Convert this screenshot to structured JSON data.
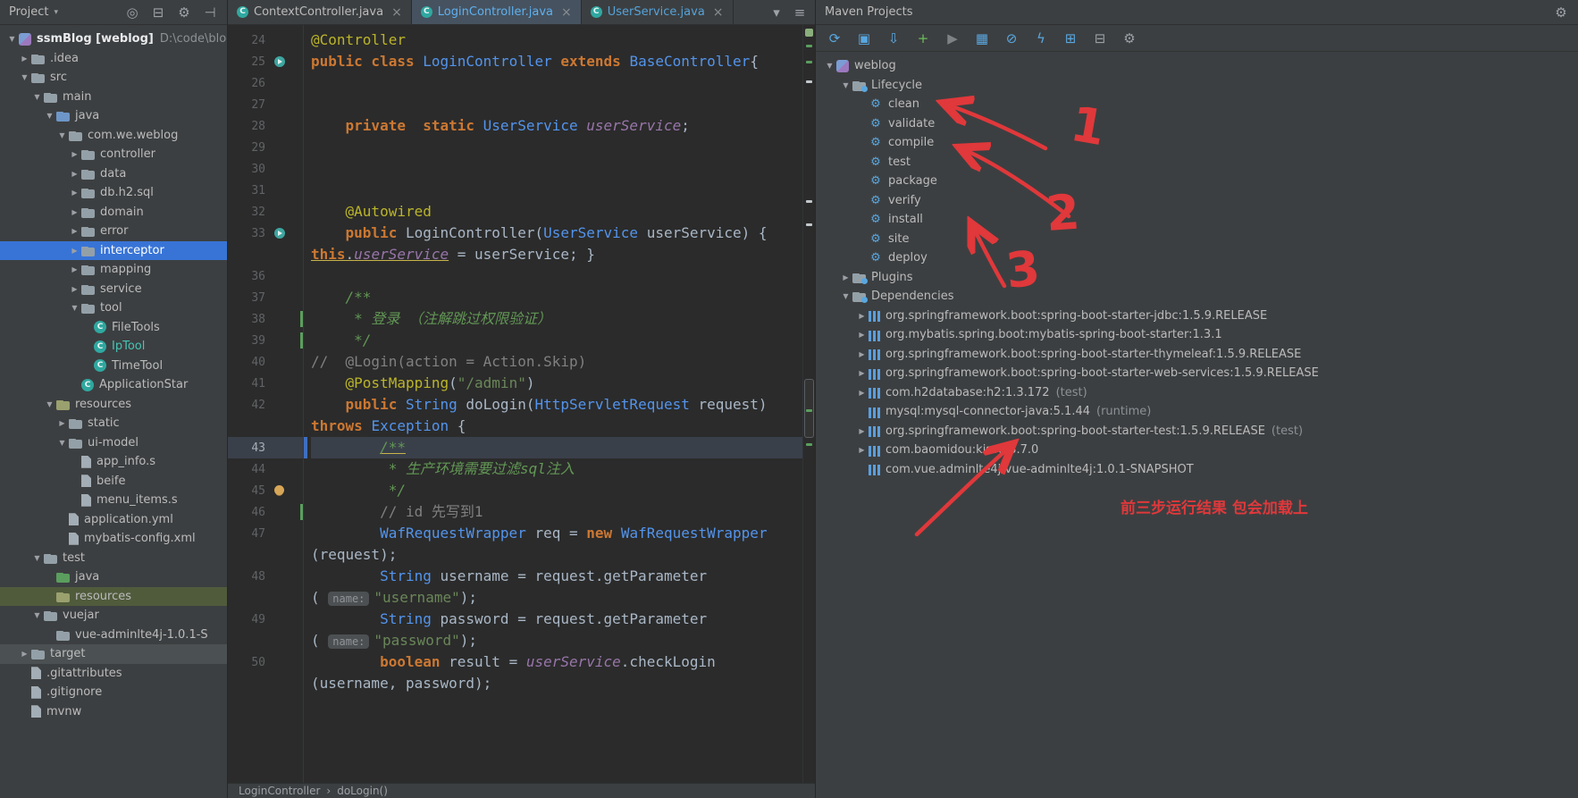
{
  "colors": {
    "selection_blue": "#3874D6",
    "annotation_red": "#E0383B",
    "keyword_orange": "#CC7832",
    "string_green": "#6A8759",
    "class_blue": "#5394EC",
    "annotation_yellow": "#BBB529",
    "doc_comment_green": "#629755",
    "panel_bg": "#3C3F41",
    "editor_bg": "#2B2B2B"
  },
  "icons": {
    "chevron_down": "▼",
    "chevron_right": "▶",
    "close": "×",
    "class_letter": "C",
    "goal_glyph": "⚙",
    "breadcrumb_sep": "›",
    "dropdown": "▾",
    "gear": "⚙"
  },
  "project_panel": {
    "title": "Project",
    "icons": [
      {
        "name": "locate-file",
        "glyph": "◎"
      },
      {
        "name": "collapse-all",
        "glyph": "⊟"
      },
      {
        "name": "settings-gear",
        "glyph": "⚙"
      },
      {
        "name": "hide-panel",
        "glyph": "⊣"
      }
    ],
    "tree": [
      {
        "label": "ssmBlog [weblog]",
        "extra": "D:\\code\\blog",
        "depth": 0,
        "arrow": "down",
        "icon": "module",
        "bold": true,
        "color": "#E8EAEC"
      },
      {
        "label": ".idea",
        "depth": 1,
        "arrow": "right",
        "icon": "folder"
      },
      {
        "label": "src",
        "depth": 1,
        "arrow": "down",
        "icon": "folder"
      },
      {
        "label": "main",
        "depth": 2,
        "arrow": "down",
        "icon": "folder"
      },
      {
        "label": "java",
        "depth": 3,
        "arrow": "down",
        "icon": "srcfolder"
      },
      {
        "label": "com.we.weblog",
        "depth": 4,
        "arrow": "down",
        "icon": "folder"
      },
      {
        "label": "controller",
        "depth": 5,
        "arrow": "right",
        "icon": "folder"
      },
      {
        "label": "data",
        "depth": 5,
        "arrow": "right",
        "icon": "folder"
      },
      {
        "label": "db.h2.sql",
        "depth": 5,
        "arrow": "right",
        "icon": "folder"
      },
      {
        "label": "domain",
        "depth": 5,
        "arrow": "right",
        "icon": "folder"
      },
      {
        "label": "error",
        "depth": 5,
        "arrow": "right",
        "icon": "folder"
      },
      {
        "label": "interceptor",
        "depth": 5,
        "arrow": "right",
        "icon": "folder",
        "selected": true
      },
      {
        "label": "mapping",
        "depth": 5,
        "arrow": "right",
        "icon": "folder"
      },
      {
        "label": "service",
        "depth": 5,
        "arrow": "right",
        "icon": "folder"
      },
      {
        "label": "tool",
        "depth": 5,
        "arrow": "down",
        "icon": "folder"
      },
      {
        "label": "FileTools",
        "depth": 6,
        "icon": "class"
      },
      {
        "label": "IpTool",
        "depth": 6,
        "icon": "class",
        "color": "#49C4B4"
      },
      {
        "label": "TimeTool",
        "depth": 6,
        "icon": "class"
      },
      {
        "label": "ApplicationStar",
        "depth": 5,
        "icon": "class"
      },
      {
        "label": "resources",
        "depth": 3,
        "arrow": "down",
        "icon": "resfolder"
      },
      {
        "label": "static",
        "depth": 4,
        "arrow": "right",
        "icon": "folder"
      },
      {
        "label": "ui-model",
        "depth": 4,
        "arrow": "down",
        "icon": "folder"
      },
      {
        "label": "app_info.s",
        "depth": 5,
        "icon": "file"
      },
      {
        "label": "beife",
        "depth": 5,
        "icon": "file"
      },
      {
        "label": "menu_items.s",
        "depth": 5,
        "icon": "file"
      },
      {
        "label": "application.yml",
        "depth": 4,
        "icon": "yml"
      },
      {
        "label": "mybatis-config.xml",
        "depth": 4,
        "icon": "xml"
      },
      {
        "label": "test",
        "depth": 2,
        "arrow": "down",
        "icon": "folder"
      },
      {
        "label": "java",
        "depth": 3,
        "icon": "testfolder"
      },
      {
        "label": "resources",
        "depth": 3,
        "icon": "resfolder",
        "rowbg": "#505B3C"
      },
      {
        "label": "vuejar",
        "depth": 2,
        "arrow": "down",
        "icon": "folder"
      },
      {
        "label": "vue-adminlte4j-1.0.1-S",
        "depth": 3,
        "icon": "folder"
      },
      {
        "label": "target",
        "depth": 1,
        "arrow": "right",
        "icon": "folder",
        "rowbg": "#4B5052"
      },
      {
        "label": ".gitattributes",
        "depth": 1,
        "icon": "file"
      },
      {
        "label": ".gitignore",
        "depth": 1,
        "icon": "file"
      },
      {
        "label": "mvnw",
        "depth": 1,
        "icon": "file"
      }
    ]
  },
  "editor": {
    "tabs": [
      {
        "label": "ContextController.java",
        "active": false,
        "tint": "#BBBBBB"
      },
      {
        "label": "LoginController.java",
        "active": true,
        "tint": "#5FB0EE"
      },
      {
        "label": "UserService.java",
        "active": false,
        "tint": "#55A2D8"
      }
    ],
    "tab_icons": [
      {
        "name": "show-tabs-list",
        "glyph": "▾"
      },
      {
        "name": "editor-options-menu",
        "glyph": "≡"
      }
    ],
    "breadcrumb": [
      "LoginController",
      "doLogin()"
    ],
    "rows": [
      {
        "num": "24",
        "seg": [
          [
            "@Controller",
            "ann"
          ]
        ]
      },
      {
        "num": "25",
        "gutter": "bean",
        "seg": [
          [
            "public class ",
            "kw"
          ],
          [
            "LoginController",
            "cls"
          ],
          [
            " ",
            "pln"
          ],
          [
            "extends",
            "kw"
          ],
          [
            " ",
            "pln"
          ],
          [
            "BaseController",
            "cls"
          ],
          [
            "{",
            "pln"
          ]
        ]
      },
      {
        "num": "26",
        "seg": []
      },
      {
        "num": "27",
        "seg": []
      },
      {
        "num": "28",
        "seg": [
          [
            "    ",
            "pln"
          ],
          [
            "private  static ",
            "kw"
          ],
          [
            "UserService",
            "cls"
          ],
          [
            " ",
            "pln"
          ],
          [
            "userService",
            "fld"
          ],
          [
            ";",
            "pln"
          ]
        ]
      },
      {
        "num": "29",
        "seg": []
      },
      {
        "num": "30",
        "seg": []
      },
      {
        "num": "31",
        "seg": []
      },
      {
        "num": "32",
        "seg": [
          [
            "    ",
            "pln"
          ],
          [
            "@Autowired",
            "ann"
          ]
        ]
      },
      {
        "num": "33",
        "gutter": "bean",
        "seg": [
          [
            "    ",
            "pln"
          ],
          [
            "public ",
            "kw"
          ],
          [
            "LoginController(",
            "pln"
          ],
          [
            "UserService",
            "cls"
          ],
          [
            " userService) { ",
            "pln"
          ]
        ]
      },
      {
        "num": "",
        "seg": [
          [
            "this",
            "kw ul"
          ],
          [
            ".",
            "pln ul"
          ],
          [
            "userService",
            "fld ul"
          ],
          [
            " = userService; }",
            "pln"
          ]
        ]
      },
      {
        "num": "36",
        "seg": []
      },
      {
        "num": "37",
        "seg": [
          [
            "    ",
            "pln"
          ],
          [
            "/**",
            "doc"
          ]
        ]
      },
      {
        "num": "38",
        "change": true,
        "seg": [
          [
            "     * 登录 （注解跳过权限验证）",
            "doc"
          ]
        ]
      },
      {
        "num": "39",
        "change": true,
        "seg": [
          [
            "     */",
            "doc"
          ]
        ]
      },
      {
        "num": "40",
        "seg": [
          [
            "//  @Login(action = Action.Skip)",
            "cmt"
          ]
        ]
      },
      {
        "num": "41",
        "seg": [
          [
            "    ",
            "pln"
          ],
          [
            "@PostMapping",
            "ann"
          ],
          [
            "(",
            "pln"
          ],
          [
            "\"/admin\"",
            "str"
          ],
          [
            ")",
            "pln"
          ]
        ]
      },
      {
        "num": "42",
        "seg": [
          [
            "    ",
            "pln"
          ],
          [
            "public ",
            "kw"
          ],
          [
            "String",
            "cls"
          ],
          [
            " doLogin(",
            "pln"
          ],
          [
            "HttpServletRequest",
            "cls"
          ],
          [
            " request)",
            "pln"
          ]
        ]
      },
      {
        "num": "",
        "seg": [
          [
            "throws",
            "kw"
          ],
          [
            " ",
            "pln"
          ],
          [
            "Exception",
            "cls"
          ],
          [
            " {",
            "pln"
          ]
        ]
      },
      {
        "num": "43",
        "caret": true,
        "seg": [
          [
            "        ",
            "pln"
          ],
          [
            "/**",
            "doc ul"
          ]
        ]
      },
      {
        "num": "44",
        "seg": [
          [
            "         * 生产环境需要过滤sql注入",
            "doc"
          ]
        ]
      },
      {
        "num": "45",
        "gutter": "bulb",
        "seg": [
          [
            "         */",
            "doc"
          ]
        ]
      },
      {
        "num": "46",
        "change": true,
        "seg": [
          [
            "        ",
            "pln"
          ],
          [
            "// id 先写到1",
            "cmt"
          ]
        ]
      },
      {
        "num": "47",
        "seg": [
          [
            "        ",
            "pln"
          ],
          [
            "WafRequestWrapper",
            "cls"
          ],
          [
            " req = ",
            "pln"
          ],
          [
            "new",
            "kw"
          ],
          [
            " ",
            "pln"
          ],
          [
            "WafRequestWrapper",
            "cls"
          ]
        ]
      },
      {
        "num": "",
        "seg": [
          [
            "(request);",
            "pln"
          ]
        ]
      },
      {
        "num": "48",
        "seg": [
          [
            "        ",
            "pln"
          ],
          [
            "String",
            "cls"
          ],
          [
            " username = request.getParameter",
            "pln"
          ]
        ]
      },
      {
        "num": "",
        "seg": [
          [
            "( ",
            "pln"
          ],
          [
            "name:",
            "hint"
          ],
          [
            "\"username\"",
            "str"
          ],
          [
            ");",
            "pln"
          ]
        ]
      },
      {
        "num": "49",
        "seg": [
          [
            "        ",
            "pln"
          ],
          [
            "String",
            "cls"
          ],
          [
            " password = request.getParameter",
            "pln"
          ]
        ]
      },
      {
        "num": "",
        "seg": [
          [
            "( ",
            "pln"
          ],
          [
            "name:",
            "hint"
          ],
          [
            "\"password\"",
            "str"
          ],
          [
            ");",
            "pln"
          ]
        ]
      },
      {
        "num": "50",
        "seg": [
          [
            "        ",
            "pln"
          ],
          [
            "boolean",
            "kw"
          ],
          [
            " result = ",
            "pln"
          ],
          [
            "userService",
            "fld"
          ],
          [
            ".checkLogin",
            "pln"
          ]
        ]
      },
      {
        "num": "",
        "seg": [
          [
            "(username, password);",
            "pln"
          ]
        ]
      }
    ]
  },
  "maven": {
    "title": "Maven Projects",
    "toolbar": [
      {
        "name": "reimport-all-maven-projects",
        "glyph": "⟳",
        "color": "#59A7E0"
      },
      {
        "name": "generate-sources",
        "glyph": "▣",
        "color": "#59A7E0"
      },
      {
        "name": "download-sources",
        "glyph": "⇩",
        "color": "#59A7E0"
      },
      {
        "name": "add-maven-project",
        "glyph": "+",
        "color": "#6CBE59"
      },
      {
        "name": "run-maven-build",
        "glyph": "▶",
        "color": "#7E8284"
      },
      {
        "name": "execute-maven-goal",
        "glyph": "▦",
        "color": "#59A7E0"
      },
      {
        "name": "toggle-offline-mode",
        "glyph": "⊘",
        "color": "#59A7E0"
      },
      {
        "name": "skip-tests-mode",
        "glyph": "ϟ",
        "color": "#59A7E0"
      },
      {
        "name": "show-dependencies",
        "glyph": "⊞",
        "color": "#59A7E0"
      },
      {
        "name": "collapse-all",
        "glyph": "⊟",
        "color": "#9AA0A6"
      },
      {
        "name": "maven-settings",
        "glyph": "⚙",
        "color": "#9AA0A6"
      }
    ],
    "tree": [
      {
        "label": "weblog",
        "depth": 0,
        "arrow": "down",
        "icon": "mavenproj"
      },
      {
        "label": "Lifecycle",
        "depth": 1,
        "arrow": "down",
        "icon": "lifecycle"
      },
      {
        "label": "clean",
        "depth": 2,
        "icon": "goal"
      },
      {
        "label": "validate",
        "depth": 2,
        "icon": "goal"
      },
      {
        "label": "compile",
        "depth": 2,
        "icon": "goal"
      },
      {
        "label": "test",
        "depth": 2,
        "icon": "goal"
      },
      {
        "label": "package",
        "depth": 2,
        "icon": "goal"
      },
      {
        "label": "verify",
        "depth": 2,
        "icon": "goal"
      },
      {
        "label": "install",
        "depth": 2,
        "icon": "goal"
      },
      {
        "label": "site",
        "depth": 2,
        "icon": "goal"
      },
      {
        "label": "deploy",
        "depth": 2,
        "icon": "goal"
      },
      {
        "label": "Plugins",
        "depth": 1,
        "arrow": "right",
        "icon": "lifecycle"
      },
      {
        "label": "Dependencies",
        "depth": 1,
        "arrow": "down",
        "icon": "lifecycle"
      },
      {
        "label": "org.springframework.boot:spring-boot-starter-jdbc:1.5.9.RELEASE",
        "depth": 2,
        "arrow": "right",
        "icon": "dep"
      },
      {
        "label": "org.mybatis.spring.boot:mybatis-spring-boot-starter:1.3.1",
        "depth": 2,
        "arrow": "right",
        "icon": "dep"
      },
      {
        "label": "org.springframework.boot:spring-boot-starter-thymeleaf:1.5.9.RELEASE",
        "depth": 2,
        "arrow": "right",
        "icon": "dep"
      },
      {
        "label": "org.springframework.boot:spring-boot-starter-web-services:1.5.9.RELEASE",
        "depth": 2,
        "arrow": "right",
        "icon": "dep"
      },
      {
        "label": "com.h2database:h2:1.3.172",
        "extra": "(test)",
        "depth": 2,
        "arrow": "right",
        "icon": "dep"
      },
      {
        "label": "mysql:mysql-connector-java:5.1.44",
        "extra": "(runtime)",
        "depth": 2,
        "icon": "dep"
      },
      {
        "label": "org.springframework.boot:spring-boot-starter-test:1.5.9.RELEASE",
        "extra": "(test)",
        "depth": 2,
        "arrow": "right",
        "icon": "dep"
      },
      {
        "label": "com.baomidou:kisso:3.7.0",
        "depth": 2,
        "arrow": "right",
        "icon": "dep"
      },
      {
        "label": "com.vue.adminlte4j:vue-adminlte4j:1.0.1-SNAPSHOT",
        "depth": 2,
        "icon": "dep"
      }
    ]
  },
  "annotations": {
    "step1": "1",
    "step2": "2",
    "step3": "3",
    "note": "前三步运行结果 包会加载上"
  }
}
